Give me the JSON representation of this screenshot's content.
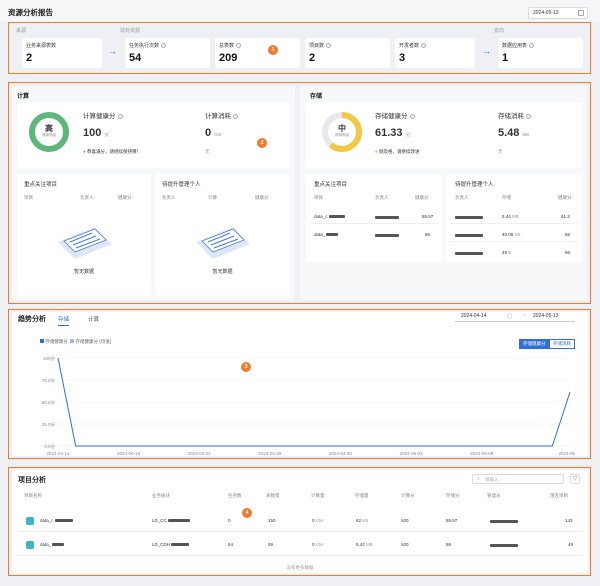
{
  "page": {
    "title": "资源分析报告",
    "date": "2024-05-13"
  },
  "sources": {
    "group_from": "来源",
    "group_have": "现有资源",
    "group_to": "去向",
    "cards": [
      {
        "label": "业务来源表数",
        "value": "2"
      },
      {
        "label": "任务执行次数",
        "value": "54"
      },
      {
        "label": "总表数",
        "value": "209"
      },
      {
        "label": "项目数",
        "value": "2"
      },
      {
        "label": "开发者数",
        "value": "3"
      },
      {
        "label": "数据应用表",
        "value": "1"
      }
    ],
    "badge": "1"
  },
  "compute": {
    "title": "计算",
    "health_label": "计算健康分",
    "ring_text": "高",
    "ring_sub": "健康等级",
    "score": "100",
    "score_unit": "分",
    "status": "恭喜满分，请继续保持哦！",
    "cost_label": "计算消耗",
    "cost_value": "0",
    "cost_unit": "CM",
    "cost_sub": "无",
    "badge": "2",
    "focus_title": "重点关注项目",
    "focus_headers": [
      "项目",
      "负责人",
      "健康分"
    ],
    "focus_empty": "暂无数据",
    "upgrade_title": "待提升管理个人",
    "upgrade_headers": [
      "负责人",
      "计算",
      "健康分"
    ],
    "upgrade_empty": "暂无数据"
  },
  "storage": {
    "title": "存储",
    "health_label": "存储健康分",
    "ring_text": "中",
    "ring_sub": "健康等级",
    "score": "61.33",
    "score_unit": "分",
    "status": "刚及格，请继续改进",
    "cost_label": "存储消耗",
    "cost_value": "5.48",
    "cost_unit": "MB",
    "cost_sub": "无",
    "focus_title": "重点关注项目",
    "focus_headers": [
      "项目",
      "负责人",
      "健康分"
    ],
    "focus_rows": [
      {
        "project": "data_c",
        "score": "85.97"
      },
      {
        "project": "data_",
        "score": "86"
      }
    ],
    "upgrade_title": "待提升管理个人",
    "upgrade_headers": [
      "负责人",
      "存储",
      "健康分"
    ],
    "upgrade_rows": [
      {
        "storage": "5.44",
        "unit": "MB",
        "score": "61.3"
      },
      {
        "storage": "40.08",
        "unit": "KB",
        "score": "86"
      },
      {
        "storage": "49",
        "unit": "B",
        "score": "86"
      }
    ]
  },
  "trend": {
    "title": "趋势分析",
    "tabs": [
      "存储",
      "计算"
    ],
    "date_from": "2024-04-14",
    "date_sep": "~",
    "date_to": "2024-05-13",
    "legend": [
      "存储健康分",
      "存储健康分 (均值)"
    ],
    "buttons": [
      "存储健康分",
      "存储消耗"
    ],
    "badge": "3"
  },
  "chart_data": {
    "type": "line",
    "x": [
      "2024-04-14",
      "2024-04-18",
      "2024-04-22",
      "2024-04-26",
      "2024-04-30",
      "2024-05-04",
      "2024-05-08",
      "2024-05-13"
    ],
    "yticks": [
      "0.0分",
      "25.0分",
      "50.0分",
      "75.0分",
      "100分"
    ],
    "ylim": [
      0,
      100
    ],
    "series": [
      {
        "name": "存储健康分",
        "color": "#2f6fd8",
        "points": [
          [
            0,
            100
          ],
          [
            1,
            0
          ],
          [
            28,
            0
          ],
          [
            29,
            61.33
          ]
        ]
      }
    ]
  },
  "projects": {
    "title": "项目分析",
    "search_placeholder": "请输入",
    "headers": [
      "项目名称",
      "业务板块",
      "任务数",
      "表数量",
      "计算量",
      "存储量",
      "计算分",
      "存储分",
      "管理员",
      "增连项目"
    ],
    "rows": [
      {
        "name": "data_c",
        "biz": "LD_CC",
        "tasks": "0",
        "tables": "150",
        "compute": "0",
        "compute_unit": "CM",
        "storage": "62",
        "storage_unit": "KB",
        "cscore": "100",
        "sscore": "85.97",
        "inc": "143"
      },
      {
        "name": "data_",
        "biz": "LD_CDH",
        "tasks": "54",
        "tables": "59",
        "compute": "0",
        "compute_unit": "CM",
        "storage": "5.42",
        "storage_unit": "MB",
        "cscore": "100",
        "sscore": "86",
        "inc": "49"
      }
    ],
    "footer": "没有更多数据",
    "badge": "4"
  }
}
